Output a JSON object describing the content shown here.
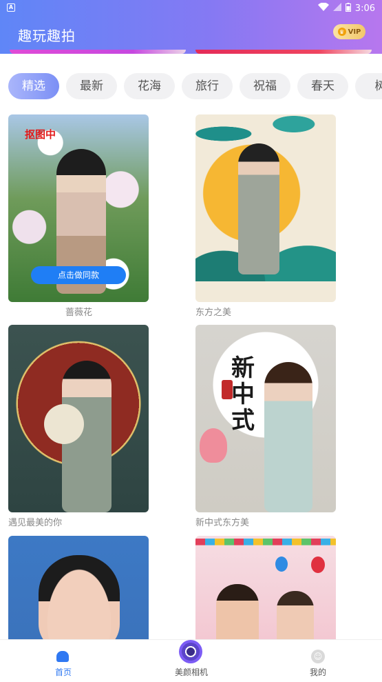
{
  "status_bar": {
    "time": "3:06",
    "left_icon": "A"
  },
  "app": {
    "title": "趣玩趣拍",
    "vip_label": "VIP"
  },
  "tabs": [
    {
      "label": "精选",
      "active": true
    },
    {
      "label": "最新",
      "active": false
    },
    {
      "label": "花海",
      "active": false
    },
    {
      "label": "旅行",
      "active": false
    },
    {
      "label": "祝福",
      "active": false
    },
    {
      "label": "春天",
      "active": false
    },
    {
      "label": "树",
      "active": false
    }
  ],
  "cards": [
    {
      "caption": "蔷薇花",
      "overlay_label": "抠图中",
      "button_label": "点击做同款"
    },
    {
      "caption": "东方之美"
    },
    {
      "caption": "遇见最美的你"
    },
    {
      "caption": "新中式东方美",
      "art_text": "新中式"
    },
    {
      "caption": ""
    },
    {
      "caption": ""
    }
  ],
  "bottom_nav": [
    {
      "label": "首页",
      "icon": "home-icon",
      "active": true
    },
    {
      "label": "美颜相机",
      "icon": "camera-icon",
      "active": false
    },
    {
      "label": "我的",
      "icon": "profile-icon",
      "active": false
    }
  ],
  "colors": {
    "accent": "#2f78f2",
    "header_start": "#5f86f7",
    "header_end": "#b777ee",
    "vip_gold": "#f2c76a"
  }
}
